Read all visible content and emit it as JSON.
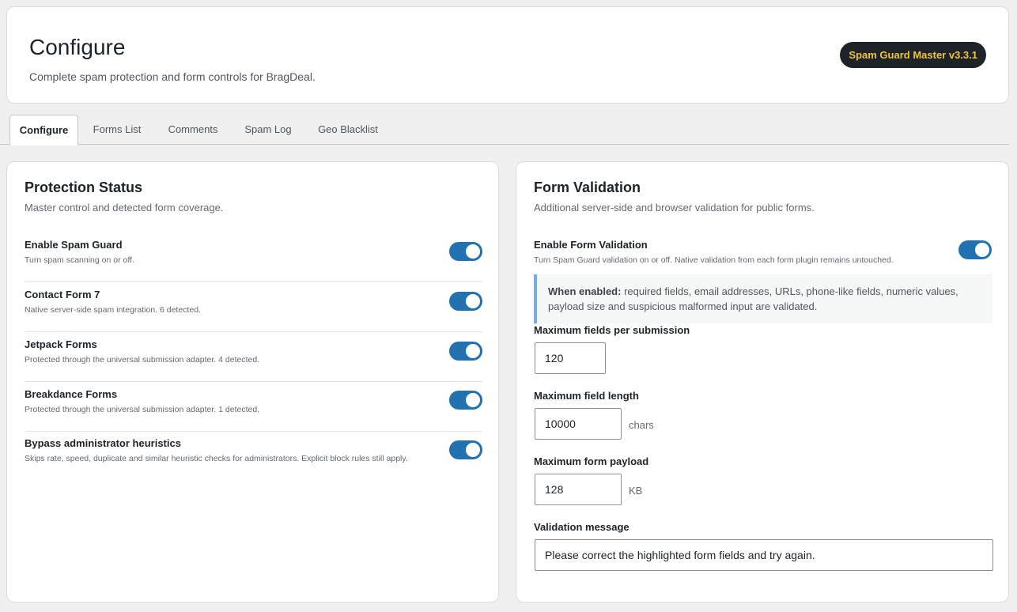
{
  "header": {
    "title": "Configure",
    "subtitle": "Complete spam protection and form controls for BragDeal.",
    "version_badge": "Spam Guard Master v3.3.1"
  },
  "tabs": [
    {
      "label": "Configure",
      "active": true
    },
    {
      "label": "Forms List",
      "active": false
    },
    {
      "label": "Comments",
      "active": false
    },
    {
      "label": "Spam Log",
      "active": false
    },
    {
      "label": "Geo Blacklist",
      "active": false
    }
  ],
  "protection": {
    "title": "Protection Status",
    "description": "Master control and detected form coverage.",
    "rows": [
      {
        "label": "Enable Spam Guard",
        "help": "Turn spam scanning on or off.",
        "enabled": true
      },
      {
        "label": "Contact Form 7",
        "help": "Native server-side spam integration. 6 detected.",
        "enabled": true
      },
      {
        "label": "Jetpack Forms",
        "help": "Protected through the universal submission adapter. 4 detected.",
        "enabled": true
      },
      {
        "label": "Breakdance Forms",
        "help": "Protected through the universal submission adapter. 1 detected.",
        "enabled": true
      },
      {
        "label": "Bypass administrator heuristics",
        "help": "Skips rate, speed, duplicate and similar heuristic checks for administrators. Explicit block rules still apply.",
        "enabled": true
      }
    ]
  },
  "validation": {
    "title": "Form Validation",
    "description": "Additional server-side and browser validation for public forms.",
    "enable_label": "Enable Form Validation",
    "enable_help": "Turn Spam Guard validation on or off. Native validation from each form plugin remains untouched.",
    "enabled": true,
    "notice_strong": "When enabled:",
    "notice_text": " required fields, email addresses, URLs, phone-like fields, numeric values, payload size and suspicious malformed input are validated.",
    "max_fields_label": "Maximum fields per submission",
    "max_fields_value": "120",
    "max_length_label": "Maximum field length",
    "max_length_value": "10000",
    "max_length_unit": "chars",
    "max_payload_label": "Maximum form payload",
    "max_payload_value": "128",
    "max_payload_unit": "KB",
    "message_label": "Validation message",
    "message_value": "Please correct the highlighted form fields and try again."
  },
  "colors": {
    "accent": "#2271b1",
    "badge_bg": "#1d2327",
    "badge_text": "#f0c33c",
    "notice_border": "#72aee6"
  }
}
